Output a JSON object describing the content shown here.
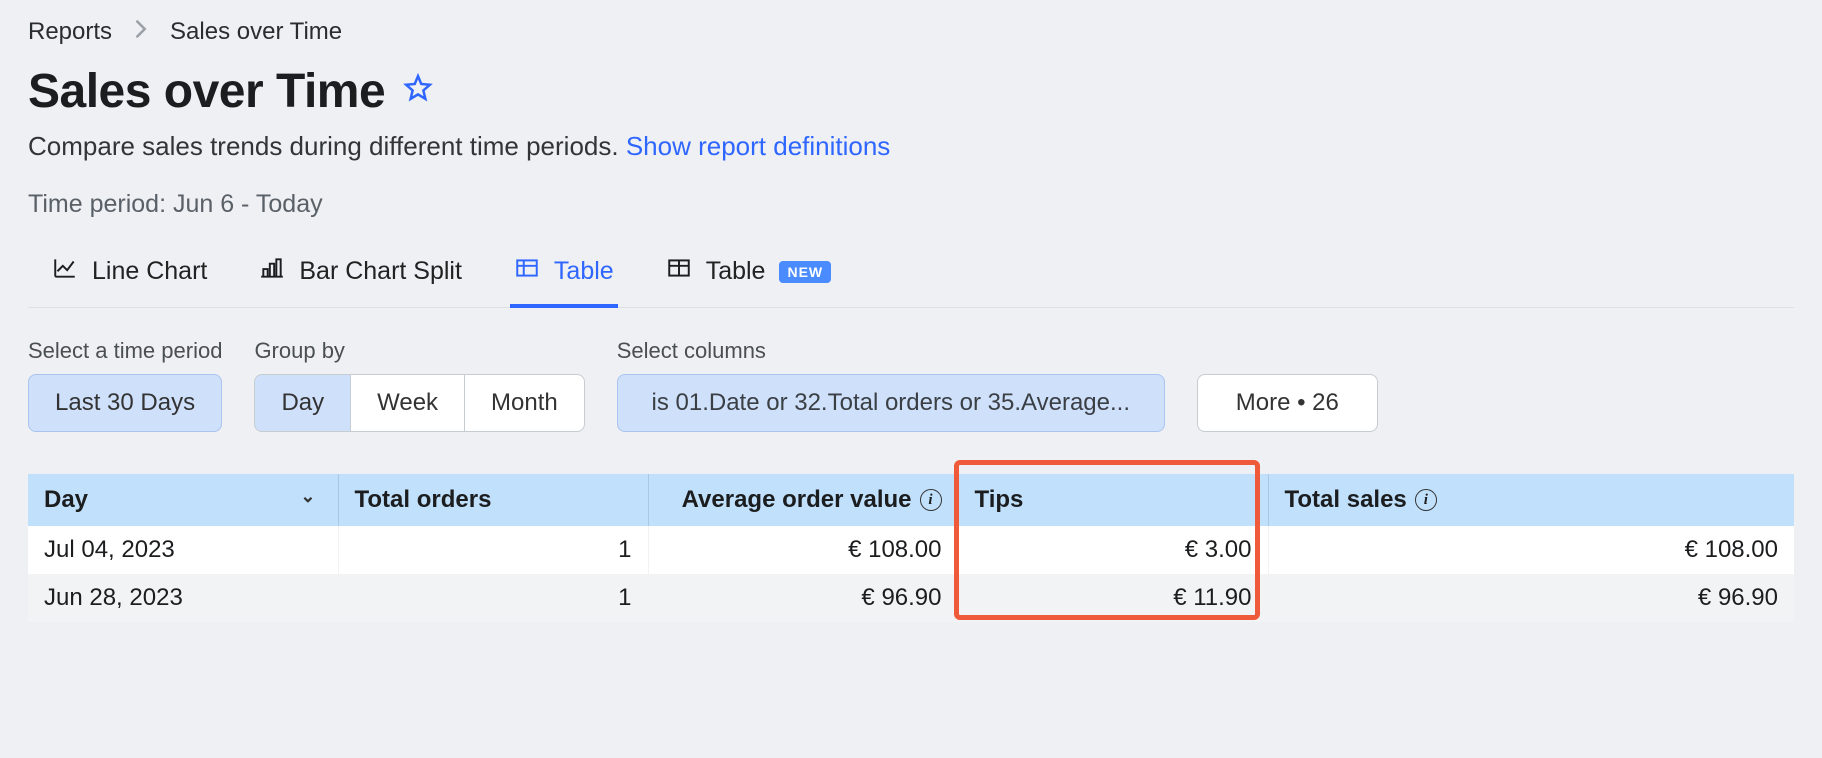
{
  "breadcrumb": {
    "root": "Reports",
    "current": "Sales over Time"
  },
  "title": "Sales over Time",
  "subtitle": {
    "text": "Compare sales trends during different time periods. ",
    "link": "Show report definitions"
  },
  "timeperiod": "Time period: Jun 6 - Today",
  "tabs": {
    "line": "Line Chart",
    "bar": "Bar Chart Split",
    "table1": "Table",
    "table2": "Table",
    "new_badge": "NEW"
  },
  "filters": {
    "period_label": "Select a time period",
    "period_value": "Last 30 Days",
    "group_label": "Group by",
    "group_day": "Day",
    "group_week": "Week",
    "group_month": "Month",
    "columns_label": "Select columns",
    "columns_value": "is 01.Date or 32.Total orders or 35.Average...",
    "more": "More • 26"
  },
  "table": {
    "headers": {
      "day": "Day",
      "total_orders": "Total orders",
      "avg": "Average order value",
      "tips": "Tips",
      "total_sales": "Total sales"
    },
    "rows": [
      {
        "day": "Jul 04, 2023",
        "orders": "1",
        "avg": "€ 108.00",
        "tips": "€ 3.00",
        "total": "€ 108.00"
      },
      {
        "day": "Jun 28, 2023",
        "orders": "1",
        "avg": "€ 96.90",
        "tips": "€ 11.90",
        "total": "€ 96.90"
      }
    ]
  }
}
